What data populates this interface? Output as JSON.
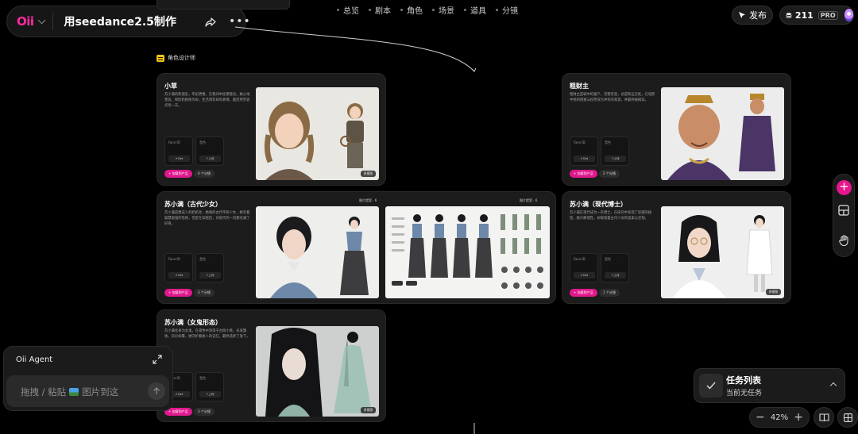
{
  "header": {
    "logo": "Oii",
    "project_title": "用seedance2.5制作",
    "nav": [
      "总览",
      "剧本",
      "角色",
      "场景",
      "道具",
      "分镜"
    ],
    "publish_label": "发布",
    "credits": "211",
    "plan": "PRO"
  },
  "canvas": {
    "section_label": "角色设计师",
    "common": {
      "face_id_label": "Face ID",
      "voice_label": "音色",
      "get_btn": "Get",
      "upload_btn": "上传",
      "reference_tag": "+ 加载到产品",
      "multi_view_badge": "多视图",
      "alt_tag": "图片提案 · 6"
    },
    "cards": [
      {
        "name": "小草",
        "desc": "苏小满的新朋友，年纪更稚，在巷间中捉摸善良。她心地善良，和奶奶相依为命，生活清贫却有真情，最后用笑容点亮一天。",
        "count_tag": "4 个分镜"
      },
      {
        "name": "苏小满（古代少女）",
        "desc": "苏小满是偶成人的奶奶孙，她真的古代平民少女，她有着聪慧倔强的性格，但是在穿越后，对现代的一切都充满了好奇。",
        "count_tag": "3 个分镜"
      },
      {
        "name": "苏小满（女鬼形态）",
        "desc": "苏小满化身为女鬼，在夜色中游荡于古街小巷，长发飘逸，衣衫如雾，她守护着故人的记忆，最终选择了放下。",
        "count_tag": "3 个分镜"
      },
      {
        "name": "粗财主",
        "desc": "粗财主是城中的富户，贪婪吝啬，总是欺压百姓，在电影中他的财富与权势成为冲突的来源，并最终被揭穿。",
        "count_tag": "2 个分镜"
      },
      {
        "name": "苏小满（现代博士）",
        "desc": "苏小满在现代成为一名博士，在研究中发现了穿越的秘密，她冷静理性，却保留着古代少女的温柔与坚韧。",
        "count_tag": "1 个分镜"
      }
    ]
  },
  "toolbar": {
    "add_icon": "plus-icon",
    "layout_icon": "layout-icon",
    "hand_icon": "hand-icon"
  },
  "agent": {
    "title": "Oii Agent",
    "placeholder_before": "拖拽 / 粘贴",
    "placeholder_after": "图片到这"
  },
  "tasks": {
    "title": "任务列表",
    "status": "当前无任务"
  },
  "zoom": {
    "minus": "−",
    "level": "42%",
    "plus": "+"
  },
  "colors": {
    "accent": "#e6158c",
    "background": "#000000",
    "card": "#1c1c1c"
  }
}
